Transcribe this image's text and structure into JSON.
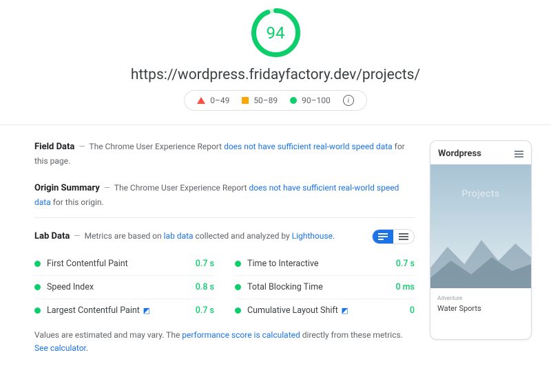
{
  "gauge": {
    "score": "94",
    "color": "#0cce6b",
    "pct": 94
  },
  "url": "https://wordpress.fridayfactory.dev/projects/",
  "legend": {
    "r1": "0–49",
    "r2": "50–89",
    "r3": "90–100"
  },
  "field": {
    "title": "Field Data",
    "pre": "The Chrome User Experience Report ",
    "link": "does not have sufficient real-world speed data",
    "post": " for this page."
  },
  "origin": {
    "title": "Origin Summary",
    "pre": "The Chrome User Experience Report ",
    "link": "does not have sufficient real-world speed data",
    "post": " for this origin."
  },
  "lab": {
    "title": "Lab Data",
    "pre": "Metrics are based on ",
    "link1": "lab data",
    "mid": " collected and analyzed by ",
    "link2": "Lighthouse",
    "post": "."
  },
  "metrics": [
    {
      "label": "First Contentful Paint",
      "value": "0.7 s",
      "flag": false
    },
    {
      "label": "Time to Interactive",
      "value": "0.7 s",
      "flag": false
    },
    {
      "label": "Speed Index",
      "value": "0.8 s",
      "flag": false
    },
    {
      "label": "Total Blocking Time",
      "value": "0 ms",
      "flag": false
    },
    {
      "label": "Largest Contentful Paint",
      "value": "0.7 s",
      "flag": true
    },
    {
      "label": "Cumulative Layout Shift",
      "value": "0",
      "flag": true
    }
  ],
  "footnote": {
    "pre": "Values are estimated and may vary. The ",
    "link1": "performance score is calculated",
    "mid": " directly from these metrics. ",
    "link2": "See calculator",
    "post": "."
  },
  "preview": {
    "site": "Wordpress",
    "hero": "Projects",
    "cat": "Adventure",
    "card_title": "Water Sports"
  }
}
